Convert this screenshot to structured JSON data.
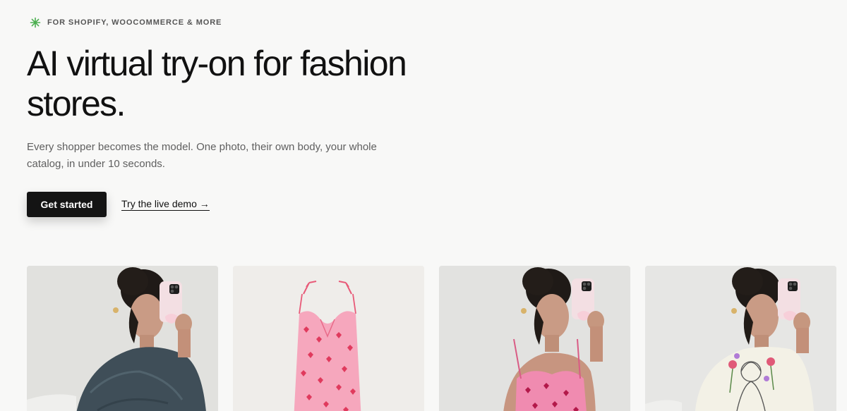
{
  "eyebrow": {
    "icon": "sparkle-icon",
    "text": "FOR SHOPIFY, WOOCOMMERCE & MORE",
    "icon_color": "#4caf50"
  },
  "hero": {
    "title_line1": "AI virtual try-on for fashion",
    "title_line2": "stores.",
    "subtitle_line1": "Every shopper becomes the model. One photo, their own body, your whole",
    "subtitle_line2": "catalog, in under 10 seconds."
  },
  "actions": {
    "primary_label": "Get started",
    "secondary_label": "Try the live demo →"
  },
  "gallery": {
    "cards": [
      {
        "name": "model-in-knit-sweater-photo",
        "bg": "#e4e4e2"
      },
      {
        "name": "pink-heart-dress-product-photo",
        "bg": "#efedea"
      },
      {
        "name": "model-in-heart-dress-photo",
        "bg": "#e2e2e0"
      },
      {
        "name": "model-in-graphic-tee-photo",
        "bg": "#e6e6e4"
      }
    ]
  },
  "colors": {
    "background": "#f8f8f7",
    "text": "#111111",
    "muted": "#5f5f5f",
    "button": "#141414"
  }
}
